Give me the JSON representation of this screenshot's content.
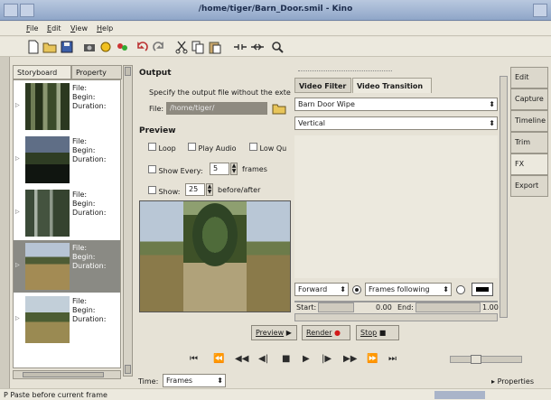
{
  "window": {
    "title": "/home/tiger/Barn_Door.smil - Kino"
  },
  "menu": [
    {
      "mn": "F",
      "rest": "ile"
    },
    {
      "mn": "E",
      "rest": "dit"
    },
    {
      "mn": "V",
      "rest": "iew"
    },
    {
      "mn": "H",
      "rest": "elp"
    }
  ],
  "toolbar": [
    "new-icon",
    "open-icon",
    "save-icon",
    "capture-icon",
    "audio-icon",
    "properties-icon",
    "undo-icon",
    "redo-icon",
    "cut-icon",
    "copy-icon",
    "paste-icon",
    "split-icon",
    "join-icon",
    "zoom-icon"
  ],
  "storyboard": {
    "tab_storyboard": "Storyboard",
    "tab_property": "Property",
    "clips": [
      {
        "file": "File:",
        "begin": "Begin:",
        "duration": "Duration:"
      },
      {
        "file": "File:",
        "begin": "Begin:",
        "duration": "Duration:"
      },
      {
        "file": "File:",
        "begin": "Begin:",
        "duration": "Duration:"
      },
      {
        "file": "File:",
        "begin": "Begin:",
        "duration": "Duration:"
      },
      {
        "file": "File:",
        "begin": "Begin:",
        "duration": "Duration:"
      }
    ],
    "selected_index": 3
  },
  "output": {
    "heading": "Output",
    "description": "Specify the output file without the exte",
    "file_label": "File:",
    "file_value": "/home/tiger/"
  },
  "preview": {
    "heading": "Preview",
    "loop": "Loop",
    "play_audio": "Play Audio",
    "low_quality": "Low Qu",
    "show_every": "Show Every:",
    "show_every_value": "5",
    "frames": "frames",
    "show": "Show:",
    "show_value": "25",
    "before_after": "before/after"
  },
  "fx": {
    "tab_filter": "Video Filter",
    "tab_transition": "Video Transition",
    "effect": "Barn Door Wipe",
    "direction": "Vertical",
    "forward": "Forward",
    "frames_following": "Frames following",
    "start_label": "Start:",
    "start_value": "0.00",
    "end_label": "End:",
    "end_value": "1.00"
  },
  "actions": {
    "preview": "Preview",
    "render": "Render",
    "stop": "Stop"
  },
  "side_tabs": [
    "Edit",
    "Capture",
    "Timeline",
    "Trim",
    "FX",
    "Export"
  ],
  "active_side_tab": "FX",
  "time": {
    "label": "Time:",
    "value": "Frames"
  },
  "properties": "Properties",
  "status": "P   Paste before current frame"
}
